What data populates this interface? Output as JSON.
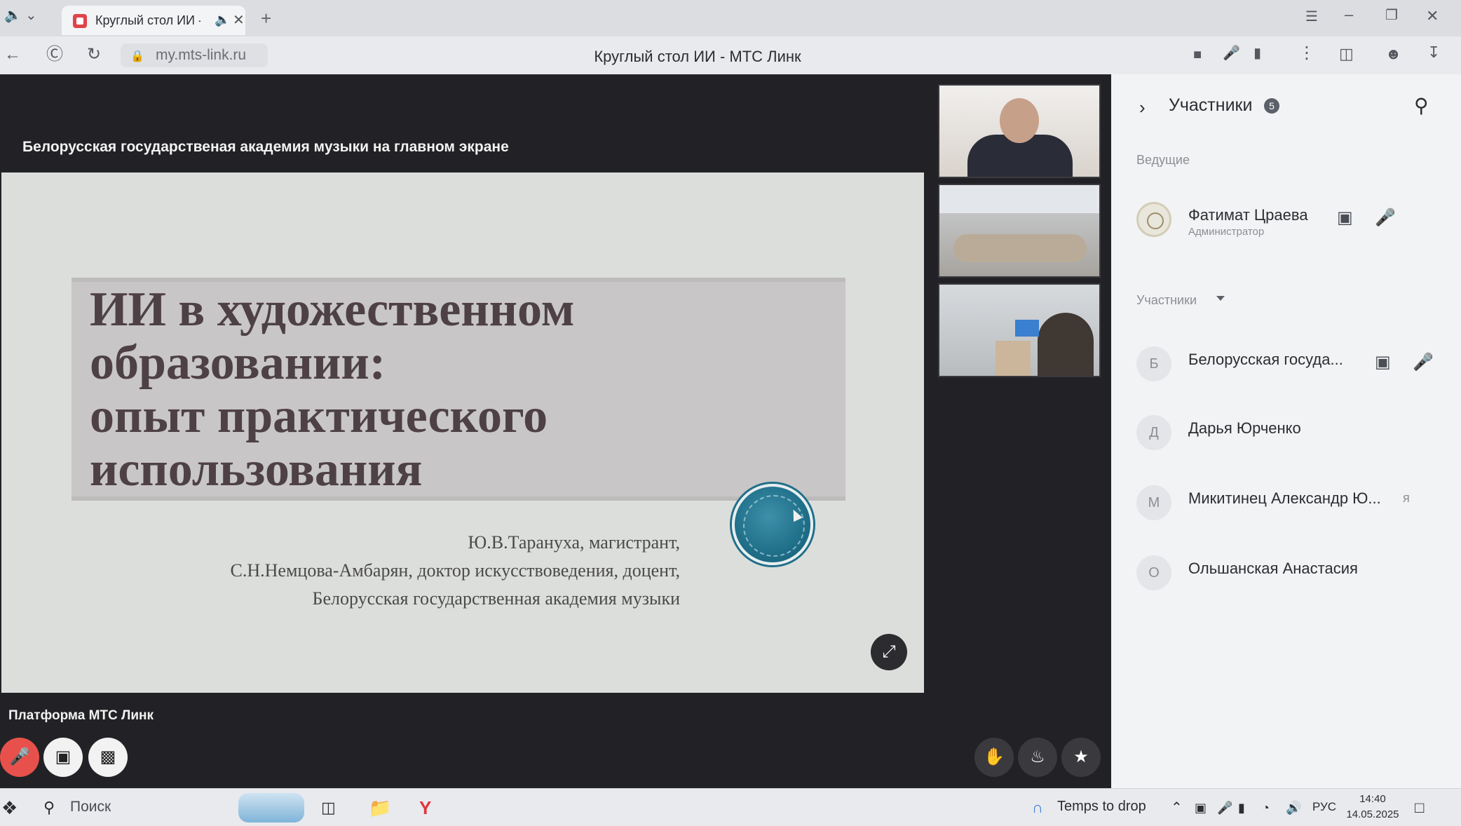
{
  "browser": {
    "tab_title": "Круглый стол ИИ - МТС Линк",
    "url": "my.mts-link.ru",
    "page_title": "Круглый стол ИИ - МТС Линк",
    "new_tab_glyph": "+",
    "close_glyph": "✕"
  },
  "stage": {
    "banner": "Белорусская государственая академия музыки на главном экране",
    "platform_label": "Платформа МТС Линк"
  },
  "slide": {
    "title": "ИИ в художественном\nобразовании:\nопыт практического\nиспользования",
    "authors": [
      "Ю.В.Тарануха, магистрант,",
      "С.Н.Немцова-Амбарян, доктор искусствоведения, доцент,",
      "Белорусская государственная академия музыки"
    ]
  },
  "panel": {
    "title": "Участники",
    "count": "5",
    "hosts_label": "Ведущие",
    "members_label": "Участники",
    "hosts": [
      {
        "name": "Фатимат Цраева",
        "role": "Администратор"
      }
    ],
    "members": [
      {
        "initial": "Б",
        "name": "Белорусская госуда..."
      },
      {
        "initial": "Д",
        "name": "Дарья Юрченко"
      },
      {
        "initial": "М",
        "name": "Микитинец Александр Ю...",
        "suffix": "я"
      },
      {
        "initial": "О",
        "name": "Ольшанская Анастасия"
      }
    ]
  },
  "taskbar": {
    "search_placeholder": "Поиск",
    "weather": "Temps to drop",
    "language": "РУС",
    "time": "14:40",
    "date": "14.05.2025"
  },
  "icons": {
    "mic_off": "mic-off-icon",
    "camera": "camera-icon",
    "screen_share": "screen-share-icon",
    "raise_hand": "raise-hand-icon",
    "fire_reaction": "fire-icon",
    "star_reaction": "star-icon",
    "fullscreen": "fullscreen-icon",
    "search": "search-icon"
  },
  "colors": {
    "mic_off_bg": "#e8514b",
    "stage_bg": "#222226",
    "panel_bg": "#f2f3f5",
    "slide_title": "#4e4145",
    "logo_teal": "#1f6f89"
  }
}
